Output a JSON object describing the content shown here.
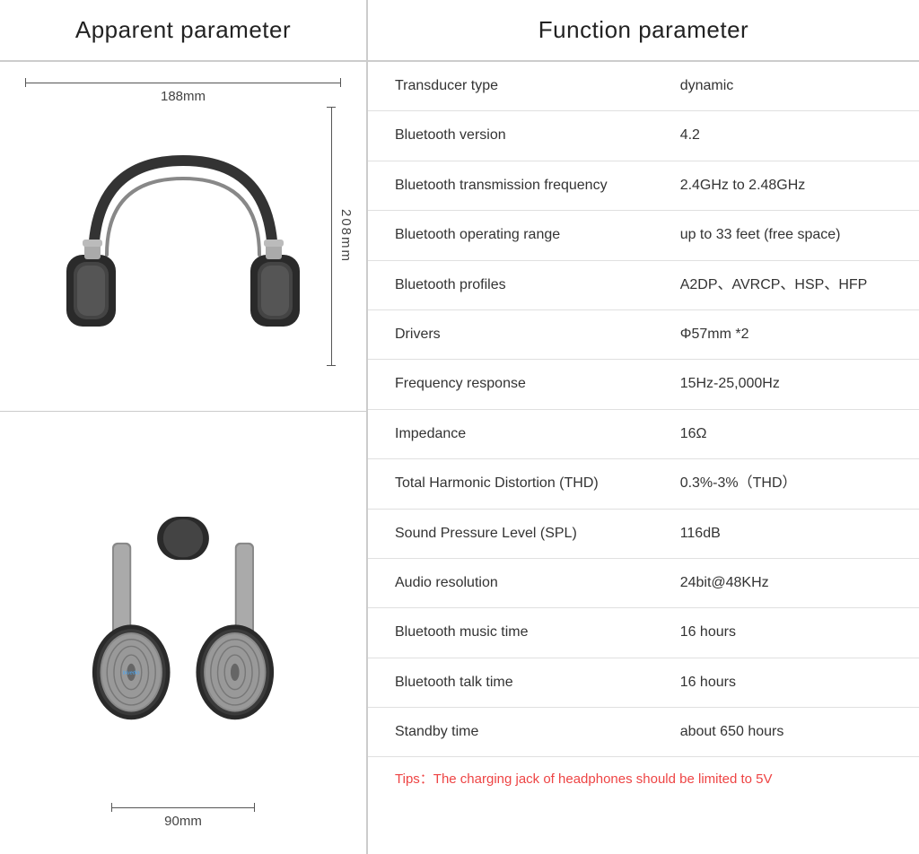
{
  "header": {
    "left_title": "Apparent parameter",
    "right_title": "Function parameter"
  },
  "dimensions": {
    "width_top": "188mm",
    "height_top": "208mm",
    "width_bottom": "90mm"
  },
  "specs": [
    {
      "label": "Transducer type",
      "value": "dynamic"
    },
    {
      "label": "Bluetooth version",
      "value": "4.2"
    },
    {
      "label": "Bluetooth transmission frequency",
      "value": "2.4GHz to 2.48GHz"
    },
    {
      "label": "Bluetooth operating range",
      "value": "up to 33 feet (free space)"
    },
    {
      "label": "Bluetooth profiles",
      "value": "A2DP、AVRCP、HSP、HFP"
    },
    {
      "label": "Drivers",
      "value": "Φ57mm  *2"
    },
    {
      "label": "Frequency response",
      "value": "15Hz-25,000Hz"
    },
    {
      "label": "Impedance",
      "value": "16Ω"
    },
    {
      "label": "Total Harmonic Distortion (THD)",
      "value": "0.3%-3%（THD）"
    },
    {
      "label": "Sound Pressure Level (SPL)",
      "value": "116dB"
    },
    {
      "label": "Audio resolution",
      "value": "24bit@48KHz"
    },
    {
      "label": "Bluetooth music time",
      "value": "16 hours"
    },
    {
      "label": "Bluetooth talk time",
      "value": "16 hours"
    },
    {
      "label": "Standby time",
      "value": "about 650 hours"
    }
  ],
  "tips": "Tips：The charging jack of headphones should be limited to 5V"
}
